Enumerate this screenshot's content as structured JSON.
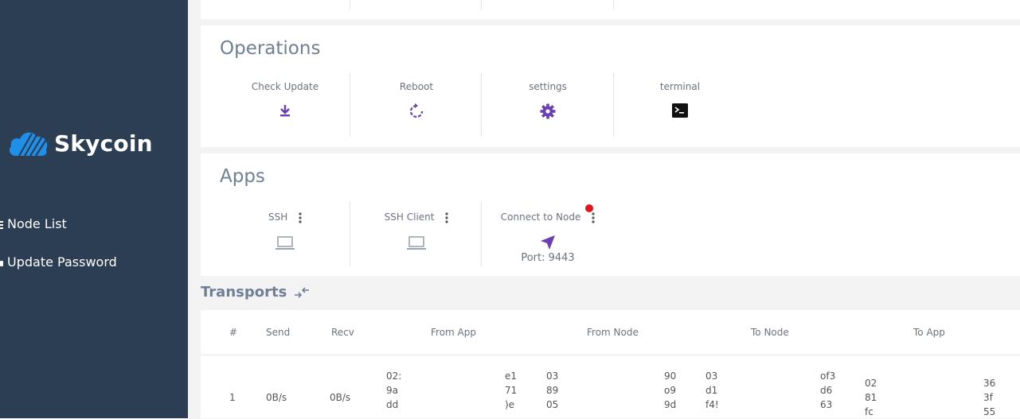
{
  "brand": {
    "name": "Skycoin"
  },
  "sidebar": {
    "items": [
      {
        "label": "Node List"
      },
      {
        "label": "Update Password"
      }
    ]
  },
  "operations": {
    "title": "Operations",
    "items": [
      {
        "label": "Check Update",
        "icon": "download-icon"
      },
      {
        "label": "Reboot",
        "icon": "reboot-icon"
      },
      {
        "label": "settings",
        "icon": "gear-icon"
      },
      {
        "label": "terminal",
        "icon": "terminal-icon"
      }
    ]
  },
  "apps": {
    "title": "Apps",
    "items": [
      {
        "label": "SSH",
        "icon": "laptop-icon"
      },
      {
        "label": "SSH Client",
        "icon": "laptop-icon"
      },
      {
        "label": "Connect to Node",
        "icon": "navigation-arrow-icon",
        "port": "Port: 9443",
        "status_color": "#e8141d"
      }
    ]
  },
  "transports": {
    "title": "Transports",
    "columns": [
      "#",
      "Send",
      "Recv",
      "From App",
      "From Node",
      "To Node",
      "To App"
    ],
    "rows": [
      {
        "index": "1",
        "send": "0B/s",
        "recv": "0B/s",
        "from_app": [
          "02:",
          "9a",
          "dd"
        ],
        "from_app_tail": [
          "e1",
          "71",
          ")e"
        ],
        "from_node": [
          "03",
          "89",
          "05"
        ],
        "from_node_tail": [
          "90",
          "o9",
          "9d"
        ],
        "to_node": [
          "03",
          "d1",
          "f4!"
        ],
        "to_node_tail": [
          "of3",
          "d6",
          "63"
        ],
        "to_app": [
          "02",
          "81",
          "fc"
        ],
        "to_app_tail": [
          "36",
          "3f",
          "55"
        ]
      }
    ]
  },
  "colors": {
    "accent": "#6a3fb5",
    "sidebar": "#2c3e54",
    "brand_blue": "#1f8fe8"
  }
}
